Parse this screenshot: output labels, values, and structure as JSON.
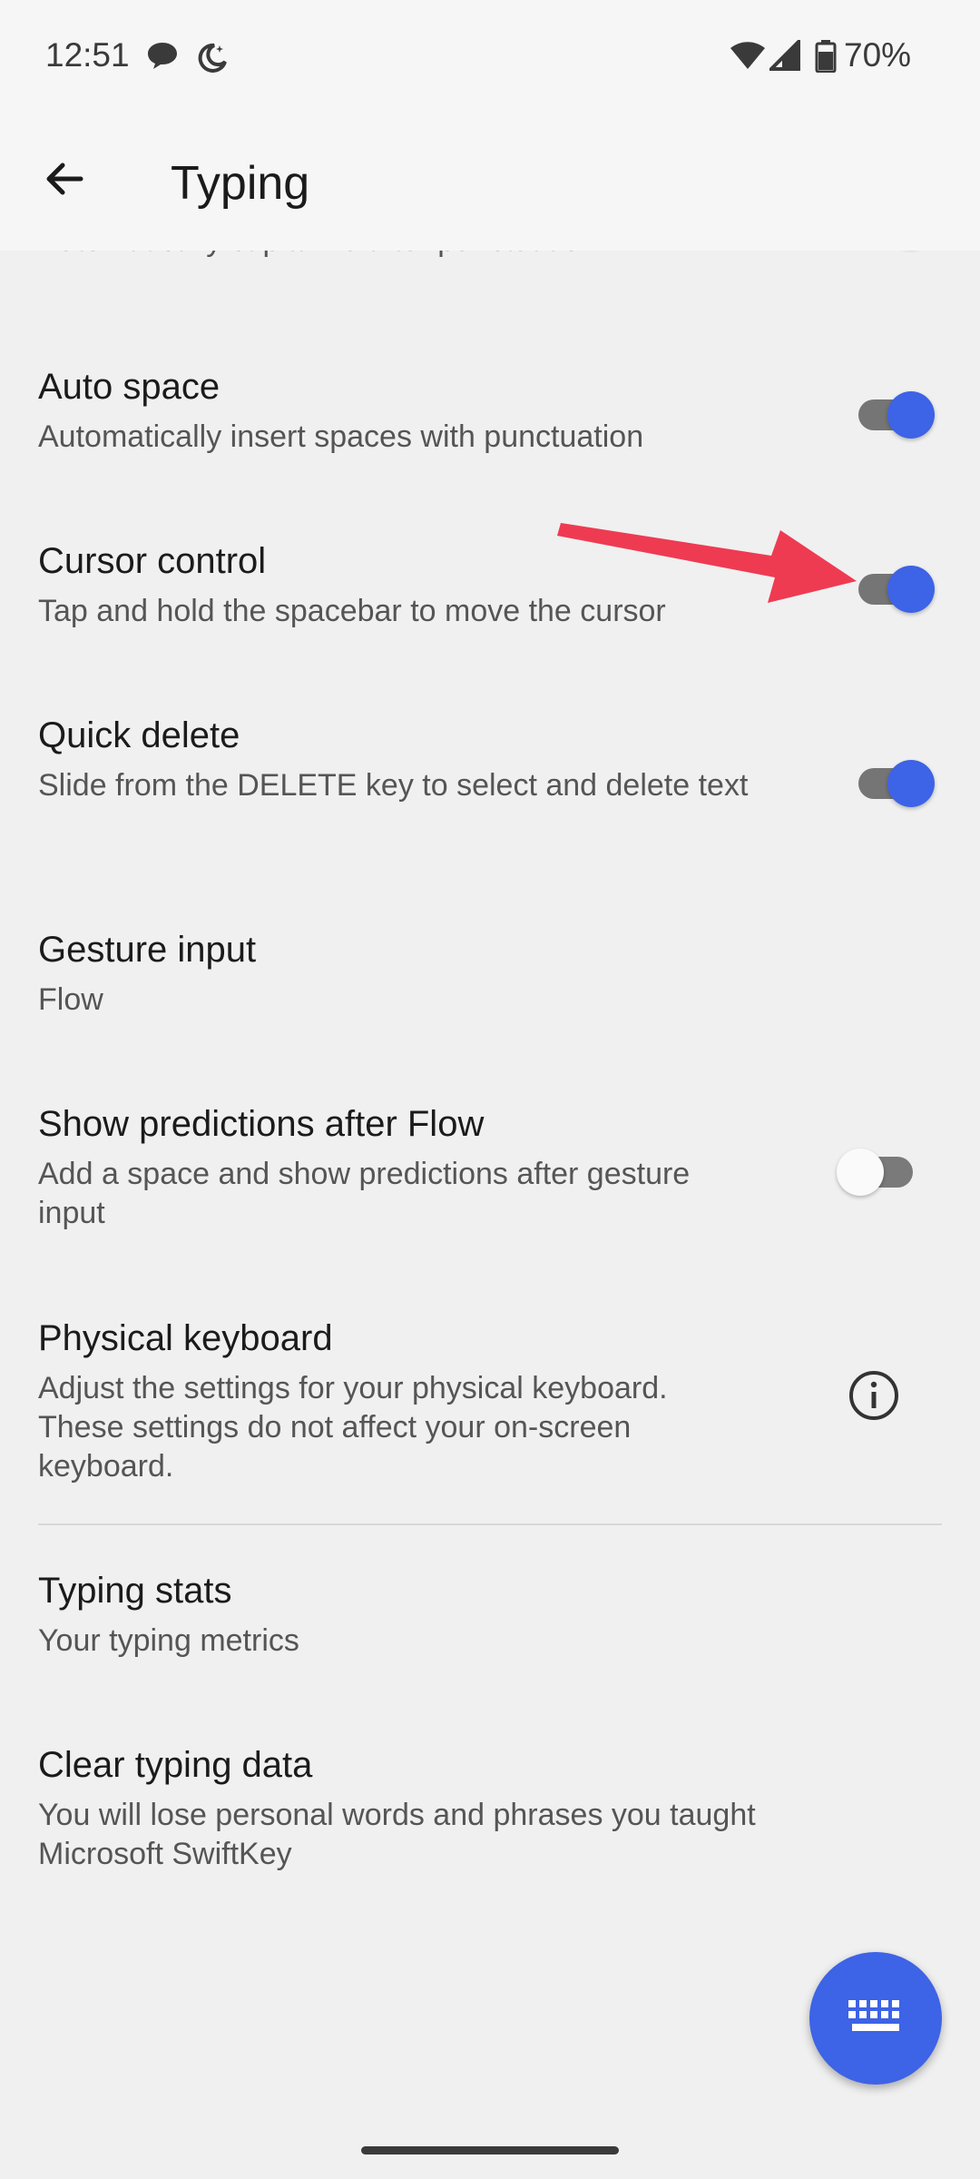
{
  "status_bar": {
    "time": "12:51",
    "battery_percent": "70%",
    "icons": [
      "chat-bubble-icon",
      "do-not-disturb-moon-icon",
      "wifi-icon",
      "cell-signal-icon",
      "battery-icon"
    ]
  },
  "app_bar": {
    "back_icon": "arrow-left-icon",
    "title": "Typing"
  },
  "settings": [
    {
      "title": "",
      "summary": "Automatically capitalize after punctuation",
      "toggle": true,
      "partially_visible": true
    },
    {
      "title": "Auto space",
      "summary": "Automatically insert spaces with punctuation",
      "toggle": true
    },
    {
      "title": "Cursor control",
      "summary": "Tap and hold the spacebar to move the cursor",
      "toggle": true
    },
    {
      "title": "Quick delete",
      "summary": "Slide from the DELETE key to select and delete text",
      "toggle": true
    },
    {
      "title": "Gesture input",
      "summary": "Flow"
    },
    {
      "title": "Show predictions after Flow",
      "summary": "Add a space and show predictions after gesture input",
      "toggle": false
    },
    {
      "title": "Physical keyboard",
      "summary": "Adjust the settings for your physical keyboard. These settings do not affect your on-screen keyboard.",
      "trailing_icon": "info-icon"
    },
    {
      "title": "Typing stats",
      "summary": "Your typing metrics"
    },
    {
      "title": "Clear typing data",
      "summary": "You will lose personal words and phrases you taught Microsoft SwiftKey"
    }
  ],
  "fab": {
    "icon": "keyboard-icon"
  },
  "annotation": {
    "icon": "red-arrow-pointer-icon",
    "color": "#ee3b52"
  },
  "colors": {
    "accent": "#3d63e6",
    "background": "#f0f0f0",
    "toggle_track_on": "#757575"
  }
}
